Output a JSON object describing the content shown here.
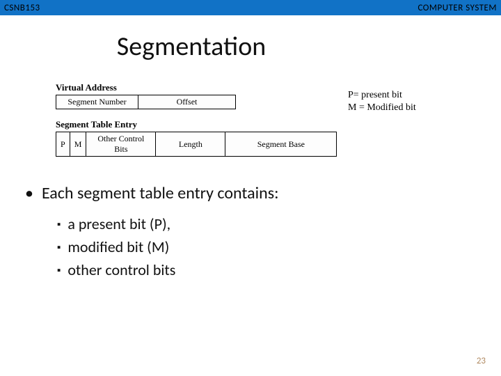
{
  "header": {
    "left": "CSNB153",
    "right": "COMPUTER SYSTEM"
  },
  "title": "Segmentation",
  "diagram": {
    "virtual_address_label": "Virtual Address",
    "virtual_address_cells": {
      "segment_number": "Segment Number",
      "offset": "Offset"
    },
    "ste_label": "Segment Table Entry",
    "ste_cells": {
      "p": "P",
      "m": "M",
      "other": "Other Control Bits",
      "length": "Length",
      "base": "Segment Base"
    },
    "legend": {
      "p": "P= present bit",
      "m": "M = Modified bit"
    }
  },
  "bullets": {
    "main": "Each segment table entry contains:",
    "items": [
      "a present bit (P),",
      "modified bit (M)",
      "other control bits"
    ]
  },
  "page_number": "23"
}
